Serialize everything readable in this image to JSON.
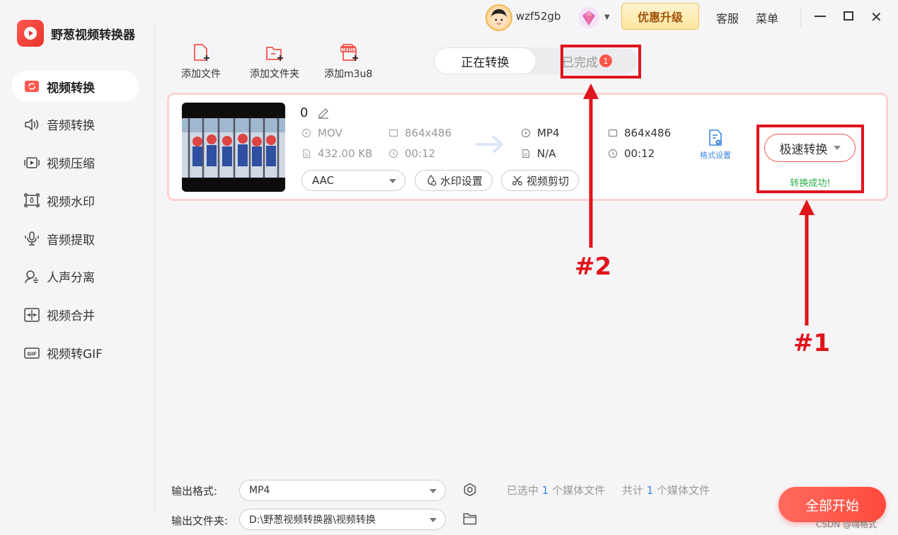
{
  "app": {
    "title": "野葱视频转换器"
  },
  "sidebar": {
    "items": [
      {
        "label": "视频转换",
        "icon": "video-convert-icon",
        "active": true
      },
      {
        "label": "音频转换",
        "icon": "audio-convert-icon",
        "active": false
      },
      {
        "label": "视频压缩",
        "icon": "video-compress-icon",
        "active": false
      },
      {
        "label": "视频水印",
        "icon": "video-watermark-icon",
        "active": false
      },
      {
        "label": "音频提取",
        "icon": "audio-extract-icon",
        "active": false
      },
      {
        "label": "人声分离",
        "icon": "vocal-separation-icon",
        "active": false
      },
      {
        "label": "视频合并",
        "icon": "video-merge-icon",
        "active": false
      },
      {
        "label": "视频转GIF",
        "icon": "video-to-gif-icon",
        "active": false
      }
    ]
  },
  "header": {
    "username": "wzf52gb",
    "upgrade_label": "优惠升级",
    "support_label": "客服",
    "menu_label": "菜单"
  },
  "toolbar": {
    "add_file": "添加文件",
    "add_folder": "添加文件夹",
    "add_m3u8": "添加m3u8",
    "m3u8_badge": "M3U8"
  },
  "tabs": {
    "converting": "正在转换",
    "completed": "已完成",
    "completed_count": "1"
  },
  "file": {
    "name": "0",
    "source_format": "MOV",
    "source_resolution": "864x486",
    "source_size": "432.00 KB",
    "source_duration": "00:12",
    "target_format": "MP4",
    "target_resolution": "864x486",
    "target_size": "N/A",
    "target_duration": "00:12",
    "audio_codec": "AAC",
    "watermark_label": "水印设置",
    "trim_label": "视频剪切",
    "format_settings_label": "格式设置",
    "convert_label": "极速转换",
    "status": "转换成功!"
  },
  "annotations": {
    "one": "#1",
    "two": "#2"
  },
  "footer": {
    "output_format_label": "输出格式:",
    "output_format_value": "MP4",
    "output_folder_label": "输出文件夹:",
    "output_folder_value": "D:\\野葱视频转换器\\视频转换",
    "selected_prefix": "已选中",
    "selected_count": "1",
    "selected_suffix": "个媒体文件",
    "total_prefix": "共计",
    "total_count": "1",
    "total_suffix": "个媒体文件",
    "start_all_label": "全部开始"
  },
  "watermark": "CSDN @嗨格式",
  "colors": {
    "accent_red": "#ff4a3d",
    "annotation_red": "#e0141c",
    "success_green": "#27b045",
    "link_blue": "#3a86e0"
  }
}
